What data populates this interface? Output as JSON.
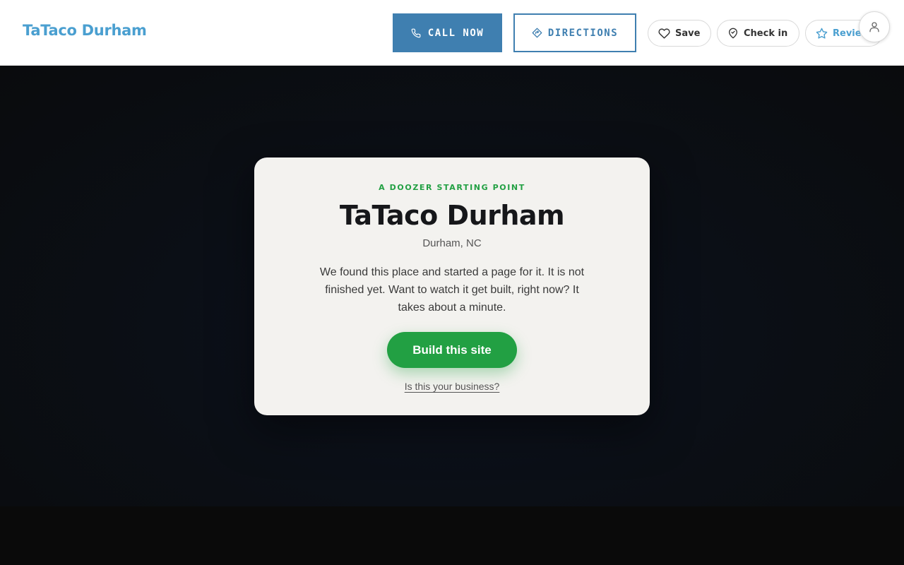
{
  "header": {
    "brand": "TaTaco Durham",
    "call_label": "CALL NOW",
    "directions_label": "DIRECTIONS",
    "save_label": "Save",
    "checkin_label": "Check in",
    "review_label": "Review"
  },
  "card": {
    "eyebrow": "A DOOZER STARTING POINT",
    "title": "TaTaco Durham",
    "location": "Durham, NC",
    "description": "We found this place and started a page for it. It is not finished yet. Want to watch it get built, right now? It takes about a minute.",
    "build_label": "Build this site",
    "claim_label": "Is this your business?"
  },
  "colors": {
    "brand_blue": "#4a9fd0",
    "button_blue": "#3f7fb0",
    "accent_green": "#22a043",
    "card_bg": "#f3f2ef",
    "hero_bg": "#0b0f16"
  },
  "icons": {
    "call": "phone-icon",
    "directions": "directions-icon",
    "save": "heart-icon",
    "checkin": "map-pin-icon",
    "review": "star-icon",
    "account": "user-icon"
  }
}
